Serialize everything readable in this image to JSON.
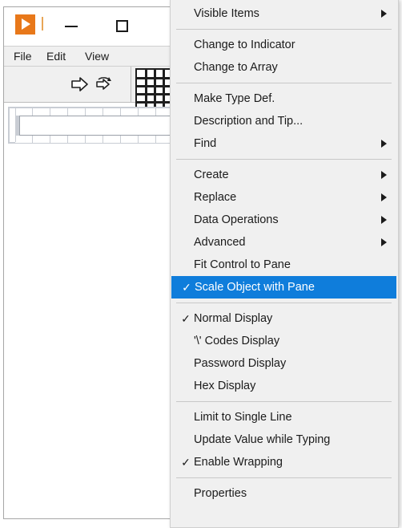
{
  "window": {
    "title_bar": {
      "app_icon": "labview-play-icon",
      "minimize_label": "Minimize",
      "maximize_label": "Maximize"
    },
    "menu_bar": [
      {
        "label": "File"
      },
      {
        "label": "Edit"
      },
      {
        "label": "View"
      }
    ],
    "toolbar": {
      "run_icon": "run-arrow-icon",
      "run_continuously_icon": "run-continuously-icon",
      "palette_icon": "palette-grid-icon"
    },
    "front_panel": {
      "string_control": "string-control"
    }
  },
  "context_menu": {
    "sections": [
      {
        "items": [
          {
            "label": "Visible Items",
            "checked": false,
            "submenu": true
          }
        ]
      },
      {
        "items": [
          {
            "label": "Change to Indicator",
            "checked": false,
            "submenu": false
          },
          {
            "label": "Change to Array",
            "checked": false,
            "submenu": false
          }
        ]
      },
      {
        "items": [
          {
            "label": "Make Type Def.",
            "checked": false,
            "submenu": false
          },
          {
            "label": "Description and Tip...",
            "checked": false,
            "submenu": false
          },
          {
            "label": "Find",
            "checked": false,
            "submenu": true
          }
        ]
      },
      {
        "items": [
          {
            "label": "Create",
            "checked": false,
            "submenu": true
          },
          {
            "label": "Replace",
            "checked": false,
            "submenu": true
          },
          {
            "label": "Data Operations",
            "checked": false,
            "submenu": true
          },
          {
            "label": "Advanced",
            "checked": false,
            "submenu": true
          },
          {
            "label": "Fit Control to Pane",
            "checked": false,
            "submenu": false
          },
          {
            "label": "Scale Object with Pane",
            "checked": true,
            "submenu": false,
            "selected": true
          }
        ]
      },
      {
        "items": [
          {
            "label": "Normal Display",
            "checked": true,
            "submenu": false
          },
          {
            "label": "'\\' Codes Display",
            "checked": false,
            "submenu": false
          },
          {
            "label": "Password Display",
            "checked": false,
            "submenu": false
          },
          {
            "label": "Hex Display",
            "checked": false,
            "submenu": false
          }
        ]
      },
      {
        "items": [
          {
            "label": "Limit to Single Line",
            "checked": false,
            "submenu": false
          },
          {
            "label": "Update Value while Typing",
            "checked": false,
            "submenu": false
          },
          {
            "label": "Enable Wrapping",
            "checked": true,
            "submenu": false
          }
        ]
      },
      {
        "items": [
          {
            "label": "Properties",
            "checked": false,
            "submenu": false
          }
        ]
      }
    ],
    "checkmark_glyph": "✓",
    "highlight_color": "#0f7ddb"
  }
}
